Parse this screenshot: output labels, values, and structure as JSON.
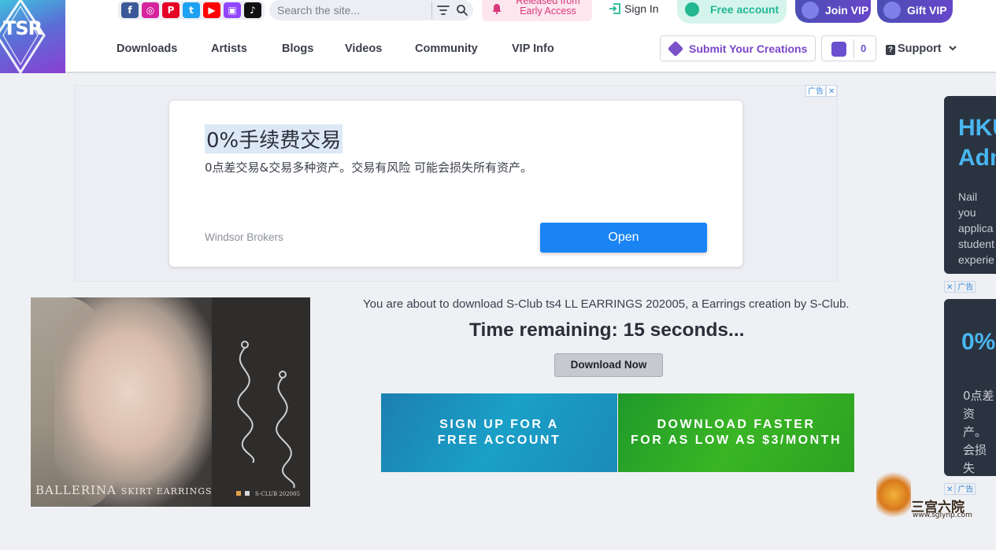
{
  "header": {
    "logo_text": "TSR",
    "social": [
      {
        "icon": "facebook-icon",
        "glyph": "f",
        "color": "#3b5998"
      },
      {
        "icon": "instagram-icon",
        "glyph": "◎",
        "color": "#d6249f"
      },
      {
        "icon": "pinterest-icon",
        "glyph": "P",
        "color": "#e60023"
      },
      {
        "icon": "twitter-icon",
        "glyph": "t",
        "color": "#1da1f2"
      },
      {
        "icon": "youtube-icon",
        "glyph": "▶",
        "color": "#ff0000"
      },
      {
        "icon": "twitch-icon",
        "glyph": "▣",
        "color": "#9146ff"
      },
      {
        "icon": "tiktok-icon",
        "glyph": "♪",
        "color": "#111111"
      }
    ],
    "search": {
      "placeholder": "Search the site..."
    },
    "early_access": {
      "line1": "Released from",
      "line2": "Early Access"
    },
    "sign_in": "Sign In",
    "free_account": "Free account",
    "join_vip": "Join VIP",
    "gift_vip": "Gift VIP"
  },
  "nav": {
    "items": [
      "Downloads",
      "Artists",
      "Blogs",
      "Videos",
      "Community",
      "VIP Info"
    ],
    "submit": "Submit Your Creations",
    "cart_count": "0",
    "support": "Support"
  },
  "ad_top": {
    "tag": "广告",
    "headline": "0%手续费交易",
    "description": "0点差交易&交易多种资产。交易有风险 可能会损失所有资产。",
    "brand": "Windsor Brokers",
    "button": "Open"
  },
  "side_ad1": {
    "title_line1": "HKU",
    "title_line2": "Adm",
    "text": [
      "Nail you",
      "applica",
      "student",
      "experie"
    ]
  },
  "side_ad_tag": "广告",
  "side_ad2": {
    "title": "0%",
    "text": [
      "0点差",
      "资产。",
      "会损失"
    ]
  },
  "preview": {
    "title": "BALLERINA",
    "subtitle": "SKIRT EARRINGS",
    "brand": "S-CLUB  202005"
  },
  "download": {
    "message": "You are about to download S-Club ts4 LL EARRINGS 202005, a Earrings creation by S-Club.",
    "timer": "Time remaining: 15 seconds...",
    "button": "Download Now"
  },
  "banners": {
    "signup_line1": "SIGN UP FOR A",
    "signup_line2": "FREE ACCOUNT",
    "faster_line1": "DOWNLOAD FASTER",
    "faster_line2": "FOR AS LOW AS $3/MONTH"
  },
  "watermark": {
    "name": "三宫六院",
    "url": "www.sglynp.com"
  },
  "colors": {
    "brand_purple": "#7b45c9",
    "vip": "#5a4ac6",
    "free": "#23b792",
    "open_button": "#1a84f5"
  }
}
